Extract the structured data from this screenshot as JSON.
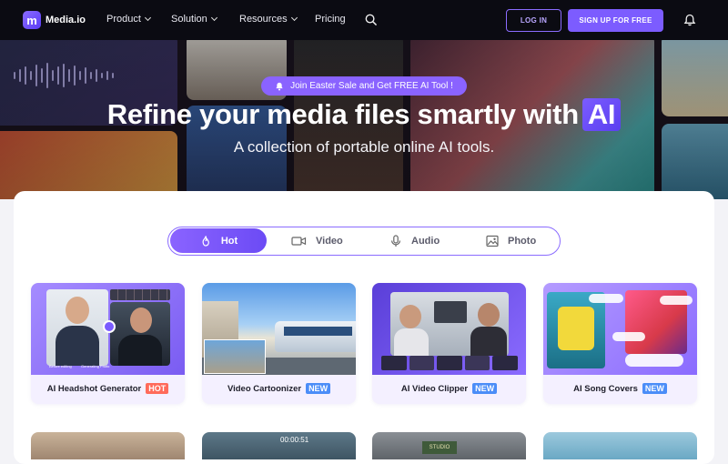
{
  "brand": {
    "name": "Media.io",
    "mark": "m"
  },
  "nav": {
    "items": [
      {
        "label": "Product",
        "dropdown": true
      },
      {
        "label": "Solution",
        "dropdown": true
      },
      {
        "label": "Resources",
        "dropdown": true
      },
      {
        "label": "Pricing",
        "dropdown": false
      }
    ],
    "login_label": "LOG IN",
    "signup_label": "SIGN UP FOR FREE"
  },
  "hero": {
    "promo": "Join Easter Sale and Get FREE AI Tool !",
    "title_main": "Refine your media files smartly with",
    "title_highlight": "AI",
    "subtitle": "A collection of portable online AI tools."
  },
  "tabs": [
    {
      "label": "Hot",
      "icon": "flame-icon",
      "active": true
    },
    {
      "label": "Video",
      "icon": "video-camera-icon",
      "active": false
    },
    {
      "label": "Audio",
      "icon": "microphone-icon",
      "active": false
    },
    {
      "label": "Photo",
      "icon": "image-icon",
      "active": false
    }
  ],
  "cards": [
    {
      "title": "AI Headshot Generator",
      "badge": "HOT",
      "thumb_text": [
        "Before editing",
        "Generating Photo"
      ]
    },
    {
      "title": "Video Cartoonizer",
      "badge": "NEW"
    },
    {
      "title": "AI Video Clipper",
      "badge": "NEW"
    },
    {
      "title": "AI Song Covers",
      "badge": "NEW"
    }
  ],
  "second_row": {
    "timer": "00:00:51",
    "studio_sign": "STUDIO"
  },
  "colors": {
    "accent": "#7c5cff",
    "hot": "#ff6b5b",
    "new": "#4b8df8",
    "nav_bg": "#0b0b12"
  }
}
